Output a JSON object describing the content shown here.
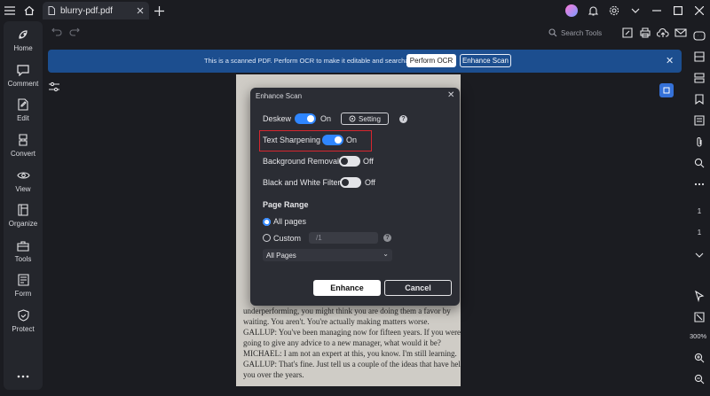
{
  "titlebar": {
    "tab_label": "blurry-pdf.pdf",
    "icons": [
      "menu-icon",
      "home-icon",
      "close-icon",
      "plus-icon",
      "avatar",
      "bell-icon",
      "gear-icon",
      "chevron-down-icon",
      "minimize-icon",
      "maximize-icon",
      "close-icon"
    ]
  },
  "sidebar": {
    "items": [
      {
        "label": "Home",
        "icon": "rocket-icon"
      },
      {
        "label": "Comment",
        "icon": "comment-icon"
      },
      {
        "label": "Edit",
        "icon": "edit-icon"
      },
      {
        "label": "Convert",
        "icon": "convert-icon"
      },
      {
        "label": "View",
        "icon": "eye-icon"
      },
      {
        "label": "Organize",
        "icon": "organize-icon"
      },
      {
        "label": "Tools",
        "icon": "toolbox-icon"
      },
      {
        "label": "Form",
        "icon": "form-icon"
      },
      {
        "label": "Protect",
        "icon": "shield-icon"
      }
    ]
  },
  "toolbar": {
    "search_label": "Search Tools"
  },
  "banner": {
    "message": "This is a scanned PDF. Perform OCR to make it editable and searchable.",
    "perform_ocr": "Perform OCR",
    "enhance_scan": "Enhance Scan"
  },
  "document": {
    "lines": [
      "underperforming, you might think you are doing them a favor by",
      "waiting. You aren't. You're actually making matters worse.",
      "GALLUP: You've been managing now for fifteen years. If you were",
      "going to give any advice to a new manager, what would it be?",
      "MICHAEL: I am not an expert at this, you know. I'm still learning.",
      "GALLUP: That's fine. Just tell us a couple of the ideas that have helped",
      "you over the years."
    ]
  },
  "right_sidebar": {
    "page_current": "1",
    "page_total": "1",
    "zoom": "300%"
  },
  "dialog": {
    "title": "Enhance Scan",
    "deskew": {
      "label": "Deskew",
      "state": "On",
      "setting": "Setting"
    },
    "text_sharpening": {
      "label": "Text Sharpening",
      "state": "On"
    },
    "background_removal": {
      "label": "Background Removal",
      "state": "Off"
    },
    "bw_filter": {
      "label": "Black and White Filter",
      "state": "Off"
    },
    "page_range": {
      "title": "Page Range",
      "all_pages": "All pages",
      "custom": "Custom",
      "custom_placeholder": "/1",
      "select_value": "All Pages"
    },
    "enhance": "Enhance",
    "cancel": "Cancel"
  },
  "colors": {
    "accent": "#2f86ff",
    "banner": "#1c4e8f",
    "highlight": "#d7262e"
  }
}
